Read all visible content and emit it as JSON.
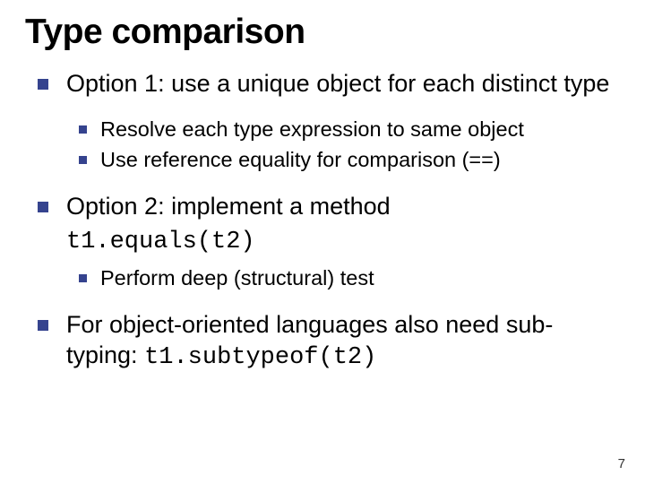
{
  "title": "Type comparison",
  "items": [
    {
      "text": "Option 1: use a unique object for each distinct type",
      "sub": [
        {
          "text": "Resolve each type expression to same object"
        },
        {
          "text": "Use reference equality for comparison (==)"
        }
      ]
    },
    {
      "text": "Option 2: implement a method",
      "code": "t1.equals(t2)",
      "sub": [
        {
          "text": "Perform deep (structural) test"
        }
      ]
    },
    {
      "text": "For object-oriented languages also need sub-typing: ",
      "trailing_code": "t1.subtypeof(t2)"
    }
  ],
  "page_number": "7"
}
